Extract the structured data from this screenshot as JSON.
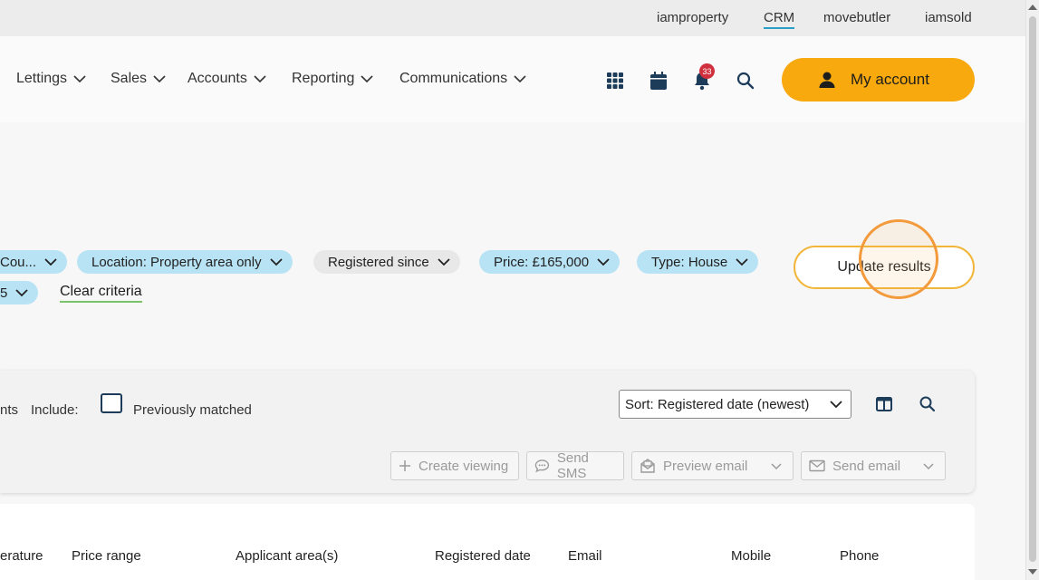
{
  "topbar": {
    "links": [
      "iamproperty",
      "CRM",
      "movebutler",
      "iamsold"
    ]
  },
  "nav": {
    "items": [
      "Lettings",
      "Sales",
      "Accounts",
      "Reporting",
      "Communications"
    ],
    "notification_count": "33",
    "account_label": "My account"
  },
  "filters": {
    "chips": [
      "Cou...",
      "Location: Property area only",
      "Registered since",
      "Price: £165,000",
      "Type: House",
      "5"
    ],
    "clear_label": "Clear criteria",
    "update_label": "Update results"
  },
  "results_panel": {
    "cut_text": "nts",
    "include_label": "Include:",
    "previously_matched_label": "Previously matched",
    "sort_value": "Sort: Registered date (newest)",
    "actions": {
      "create_viewing": "Create viewing",
      "send_sms": "Send SMS",
      "preview_email": "Preview email",
      "send_email": "Send email"
    }
  },
  "table": {
    "columns": [
      "erature",
      "Price range",
      "Applicant area(s)",
      "Registered date",
      "Email",
      "Mobile",
      "Phone"
    ]
  },
  "colors": {
    "accent": "#f7a90e",
    "chip": "#b8e3f4",
    "link_underline": "#7ac36a"
  }
}
